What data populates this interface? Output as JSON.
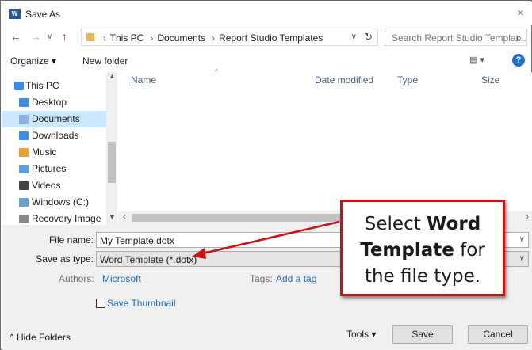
{
  "window": {
    "title": "Save As",
    "app_icon_text": "W",
    "close_glyph": "×"
  },
  "address": {
    "crumbs": [
      "This PC",
      "Documents",
      "Report Studio Templates"
    ],
    "search_placeholder": "Search Report Studio Templat..."
  },
  "toolbar": {
    "organize_label": "Organize ▾",
    "new_folder_label": "New folder",
    "view_glyph": "▤ ▾",
    "help_glyph": "?"
  },
  "nav": {
    "items": [
      {
        "label": "This PC",
        "icon": "pc-icon",
        "color": "#3b8ee8"
      },
      {
        "label": "Desktop",
        "icon": "desktop-icon",
        "color": "#3b8ee8"
      },
      {
        "label": "Documents",
        "icon": "documents-icon",
        "color": "#8ab4e0"
      },
      {
        "label": "Downloads",
        "icon": "downloads-icon",
        "color": "#3b8ee8"
      },
      {
        "label": "Music",
        "icon": "music-icon",
        "color": "#f0a030"
      },
      {
        "label": "Pictures",
        "icon": "pictures-icon",
        "color": "#5aa0e0"
      },
      {
        "label": "Videos",
        "icon": "videos-icon",
        "color": "#444444"
      },
      {
        "label": "Windows (C:)",
        "icon": "drive-icon",
        "color": "#6aa0d0"
      },
      {
        "label": "Recovery Image",
        "icon": "drive-icon",
        "color": "#888888"
      }
    ],
    "selected": "Documents"
  },
  "filelist": {
    "columns": [
      "Name",
      "Date modified",
      "Type",
      "Size"
    ]
  },
  "form": {
    "file_name_label": "File name:",
    "file_name_value": "My Template.dotx",
    "save_type_label": "Save as type:",
    "save_type_value": "Word Template (*.dotx)",
    "authors_label": "Authors:",
    "authors_value": "Microsoft",
    "tags_label": "Tags:",
    "tags_value": "Add a tag",
    "thumbnail_label": "Save Thumbnail",
    "hide_folders_label": "Hide Folders",
    "tools_label": "Tools",
    "save_label": "Save",
    "cancel_label": "Cancel"
  },
  "callout": {
    "line1_pre": "Select ",
    "line1_bold": "Word",
    "line2_bold": "Template",
    "line2_post": " for",
    "line3": "the file type.",
    "border_color": "#cc1111"
  }
}
